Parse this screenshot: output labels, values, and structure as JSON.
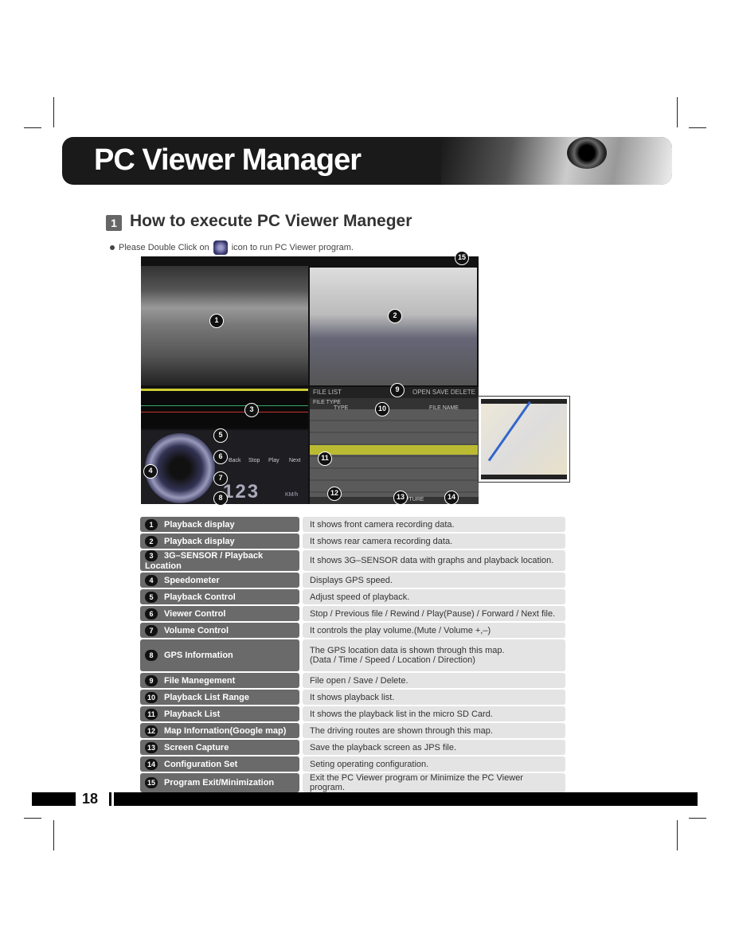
{
  "header": {
    "title": "PC Viewer Manager"
  },
  "section": {
    "number": "1",
    "title": "How to execute PC Viewer Maneger"
  },
  "instruction": {
    "before": "Please Double Click on",
    "after": "icon to run PC Viewer program."
  },
  "viewer": {
    "file_list": "FILE LIST",
    "open": "OPEN",
    "save": "SAVE",
    "delete": "DELETE",
    "file_type": "FILE TYPE",
    "type_col": "TYPE",
    "file_name_col": "FILE NAME",
    "back": "Back",
    "stop": "Stop",
    "play": "Play",
    "next": "Next",
    "speed": "123",
    "speed_unit": "KM/h",
    "capture": "CAPTURE",
    "callouts": [
      "1",
      "2",
      "3",
      "4",
      "5",
      "6",
      "7",
      "8",
      "9",
      "10",
      "11",
      "12",
      "13",
      "14",
      "15"
    ]
  },
  "table": [
    {
      "num": "1",
      "name": "Playback display",
      "desc": "It shows front camera recording data."
    },
    {
      "num": "2",
      "name": "Playback display",
      "desc": "It shows rear camera recording data."
    },
    {
      "num": "3",
      "name": "3G–SENSOR / Playback Location",
      "desc": "It shows 3G–SENSOR data with graphs and playback location."
    },
    {
      "num": "4",
      "name": "Speedometer",
      "desc": "Displays GPS speed."
    },
    {
      "num": "5",
      "name": "Playback Control",
      "desc": "Adjust speed of playback."
    },
    {
      "num": "6",
      "name": "Viewer Control",
      "desc": "Stop / Previous file / Rewind / Play(Pause) / Forward / Next file."
    },
    {
      "num": "7",
      "name": "Volume Control",
      "desc": "It controls the play volume.(Mute / Volume +,–)"
    },
    {
      "num": "8",
      "name": "GPS Information",
      "desc": "The GPS location data is shown through this map.",
      "desc2": "(Data / Time / Speed / Location / Direction)"
    },
    {
      "num": "9",
      "name": "File Manegement",
      "desc": "File open / Save / Delete."
    },
    {
      "num": "10",
      "name": "Playback List Range",
      "desc": "It shows playback list."
    },
    {
      "num": "11",
      "name": "Playback List",
      "desc": "It shows the playback list in the micro SD Card."
    },
    {
      "num": "12",
      "name": "Map Infornation(Google map)",
      "desc": "The driving routes are shown through this map."
    },
    {
      "num": "13",
      "name": "Screen Capture",
      "desc": "Save the playback screen as JPS file."
    },
    {
      "num": "14",
      "name": "Configuration Set",
      "desc": "Seting operating configuration."
    },
    {
      "num": "15",
      "name": "Program Exit/Minimization",
      "desc": "Exit the PC Viewer program or Minimize the PC Viewer program."
    }
  ],
  "footer": {
    "page": "18"
  }
}
